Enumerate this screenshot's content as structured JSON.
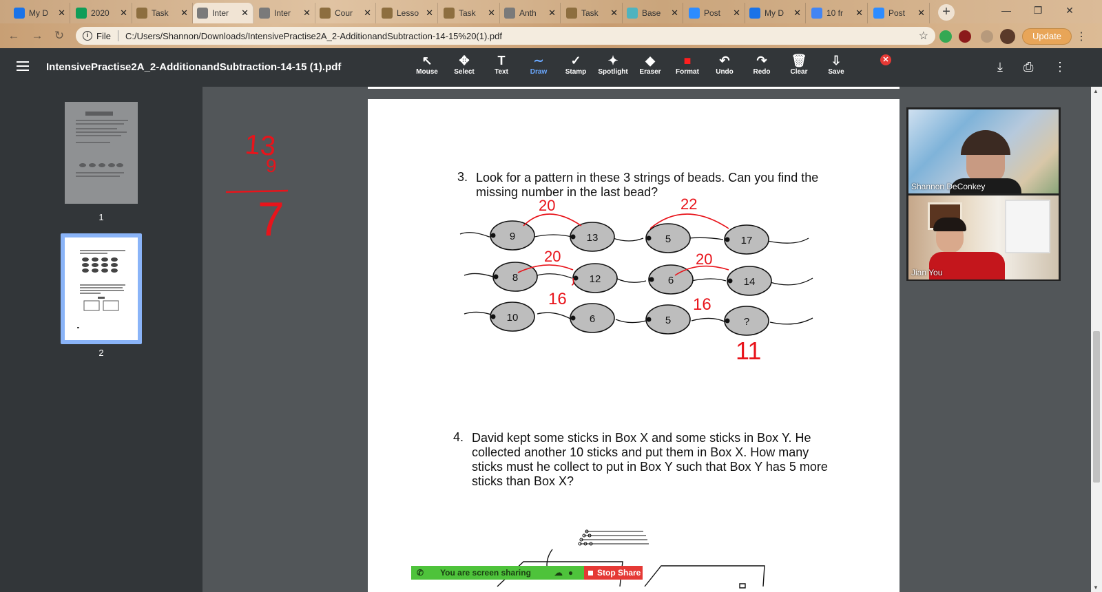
{
  "tabs": [
    {
      "title": "My D",
      "color": "#1a73e8"
    },
    {
      "title": "2020",
      "color": "#0f9d58"
    },
    {
      "title": "Task",
      "color": "#8d6e3f"
    },
    {
      "title": "Inter",
      "color": "#7a7a7a",
      "active": true
    },
    {
      "title": "Inter",
      "color": "#7a7a7a"
    },
    {
      "title": "Cour",
      "color": "#8d6e3f"
    },
    {
      "title": "Lesso",
      "color": "#8d6e3f"
    },
    {
      "title": "Task",
      "color": "#8d6e3f"
    },
    {
      "title": "Anth",
      "color": "#7a7a7a"
    },
    {
      "title": "Task",
      "color": "#8d6e3f"
    },
    {
      "title": "Base",
      "color": "#4fb3bf"
    },
    {
      "title": "Post",
      "color": "#2d8cff"
    },
    {
      "title": "My D",
      "color": "#1a73e8"
    },
    {
      "title": "10 fr",
      "color": "#4285f4"
    },
    {
      "title": "Post",
      "color": "#2d8cff"
    }
  ],
  "tab_close": "✕",
  "new_tab": "+",
  "window_controls": {
    "minimize": "—",
    "restore": "❐",
    "close": "✕"
  },
  "address": {
    "scheme_label": "File",
    "url": "C:/Users/Shannon/Downloads/IntensivePractise2A_2-AdditionandSubtraction-14-15%20(1).pdf",
    "update_label": "Update"
  },
  "pdf": {
    "title": "IntensivePractise2A_2-AdditionandSubtraction-14-15 (1).pdf",
    "tools": [
      {
        "label": "Mouse",
        "icon": "↖"
      },
      {
        "label": "Select",
        "icon": "✥"
      },
      {
        "label": "Text",
        "icon": "T"
      },
      {
        "label": "Draw",
        "icon": "∼",
        "active": true
      },
      {
        "label": "Stamp",
        "icon": "✓"
      },
      {
        "label": "Spotlight",
        "icon": "✦"
      },
      {
        "label": "Eraser",
        "icon": "◆"
      },
      {
        "label": "Format",
        "icon": "■"
      },
      {
        "label": "Undo",
        "icon": "↶"
      },
      {
        "label": "Redo",
        "icon": "↷"
      },
      {
        "label": "Clear",
        "icon": "🗑"
      },
      {
        "label": "Save",
        "icon": "⇩"
      }
    ],
    "close_annotation": "✕",
    "format_color": "#ff1f1f"
  },
  "sidebar": {
    "pages": [
      {
        "number": "1"
      },
      {
        "number": "2"
      }
    ]
  },
  "document": {
    "q3_number": "3.",
    "q3_line1": "Look for a pattern in these 3 strings of beads. Can you find the",
    "q3_line2": "missing number in the last bead?",
    "bead_rows": [
      [
        "9",
        "13",
        "5",
        "17"
      ],
      [
        "8",
        "12",
        "6",
        "14"
      ],
      [
        "10",
        "6",
        "5",
        "?"
      ]
    ],
    "q4_number": "4.",
    "q4_lines": [
      "David kept some sticks in Box X and some sticks in Box Y. He",
      "collected another 10 sticks and put them in Box X. How many",
      "sticks must he collect to put in Box Y such that Box Y has 5 more",
      "sticks than Box X?"
    ],
    "ink_color": "#e8141b",
    "annotations": [
      "20",
      "22",
      "20",
      "20",
      "16",
      "16",
      "11"
    ],
    "side_sum": [
      "13",
      "9",
      "7"
    ]
  },
  "participants": [
    {
      "name": "Shannon DeConkey"
    },
    {
      "name": "Jian You"
    }
  ],
  "share": {
    "status": "You are screen sharing",
    "stop_label": "Stop Share"
  }
}
